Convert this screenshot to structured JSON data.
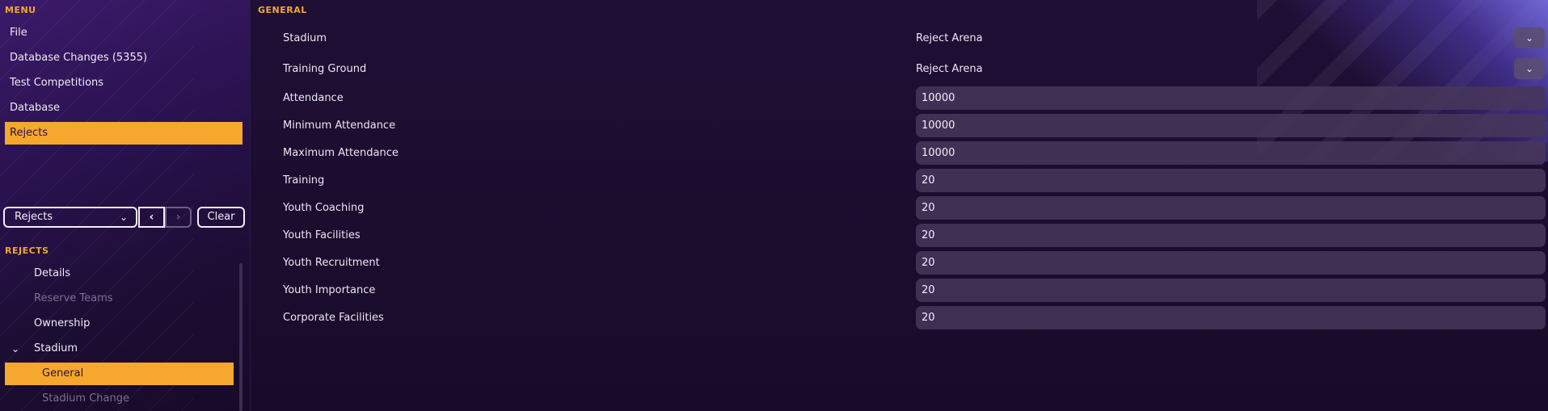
{
  "menu": {
    "title": "MENU",
    "items": [
      {
        "label": "File"
      },
      {
        "label": "Database Changes (5355)"
      },
      {
        "label": "Test Competitions"
      },
      {
        "label": "Database"
      },
      {
        "label": "Rejects"
      }
    ]
  },
  "toolbar": {
    "dropdown_value": "Rejects",
    "prev_label": "‹",
    "next_label": "›",
    "clear_label": "Clear"
  },
  "rejects": {
    "title": "REJECTS",
    "items": [
      {
        "label": "Details"
      },
      {
        "label": "Reserve Teams"
      },
      {
        "label": "Ownership"
      },
      {
        "label": "Stadium"
      },
      {
        "label": "General"
      },
      {
        "label": "Stadium Change"
      }
    ]
  },
  "general": {
    "title": "GENERAL",
    "rows": [
      {
        "label": "Stadium",
        "value": "Reject Arena"
      },
      {
        "label": "Training Ground",
        "value": "Reject Arena"
      },
      {
        "label": "Attendance",
        "value": "10000"
      },
      {
        "label": "Minimum Attendance",
        "value": "10000"
      },
      {
        "label": "Maximum Attendance",
        "value": "10000"
      },
      {
        "label": "Training",
        "value": "20"
      },
      {
        "label": "Youth Coaching",
        "value": "20"
      },
      {
        "label": "Youth Facilities",
        "value": "20"
      },
      {
        "label": "Youth Recruitment",
        "value": "20"
      },
      {
        "label": "Youth Importance",
        "value": "20"
      },
      {
        "label": "Corporate Facilities",
        "value": "20"
      }
    ]
  },
  "colors": {
    "accent": "#f5a72e",
    "background": "#1b0d2e",
    "field": "#463759"
  }
}
